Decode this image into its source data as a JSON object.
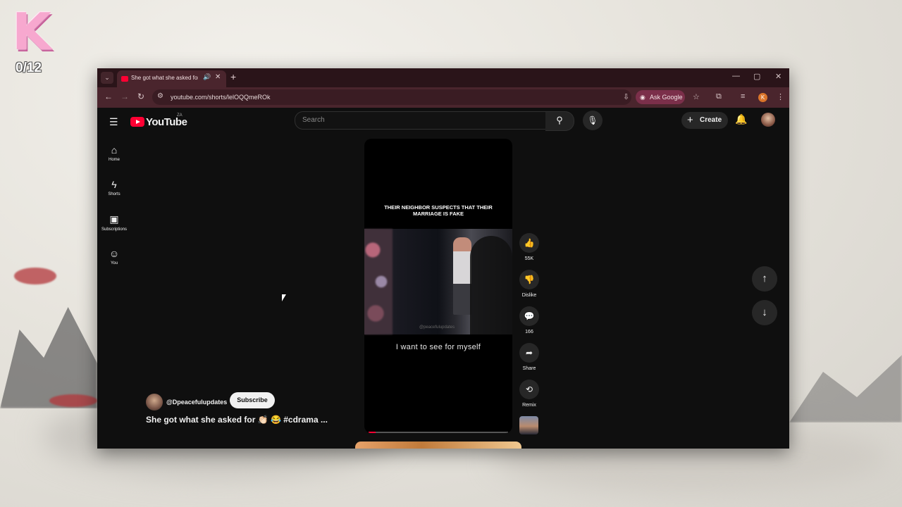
{
  "overlay": {
    "badge_letter": "K",
    "counter": "0/12"
  },
  "browser": {
    "tab_list_icon": "chevron-down-icon",
    "tab_title": "She got what she asked for",
    "tab_close": "✕",
    "new_tab": "+",
    "url": "youtube.com/shorts/lelOQQmeROk",
    "ask_google": "Ask Google",
    "profile_initial": "K",
    "window_controls": {
      "minimize": "—",
      "maximize": "▢",
      "close": "✕"
    }
  },
  "youtube": {
    "logo_word": "YouTube",
    "country_code": "ZA",
    "search_placeholder": "Search",
    "create_label": "Create",
    "sidebar": [
      {
        "icon": "home-icon",
        "label": "Home"
      },
      {
        "icon": "shorts-icon",
        "label": "Shorts"
      },
      {
        "icon": "subscriptions-icon",
        "label": "Subscriptions"
      },
      {
        "icon": "you-icon",
        "label": "You"
      }
    ],
    "short": {
      "caption": "THEIR NEIGHBOR SUSPECTS THAT THEIR MARRIAGE IS FAKE",
      "watermark": "@peacefulupdates",
      "subtitle": "I want to see for myself",
      "progress": 0.05
    },
    "actions": {
      "like_count": "55K",
      "dislike_label": "Dislike",
      "comment_count": "166",
      "share_label": "Share",
      "remix_label": "Remix"
    },
    "channel": "@Dpeacefulupdates",
    "subscribe_label": "Subscribe",
    "video_title": "She got what she asked for 👏🏻 😂 #cdrama ..."
  },
  "colors": {
    "yt_red": "#ff0033",
    "browser_frame": "#4a252d",
    "page_bg": "#0f0f0f"
  }
}
